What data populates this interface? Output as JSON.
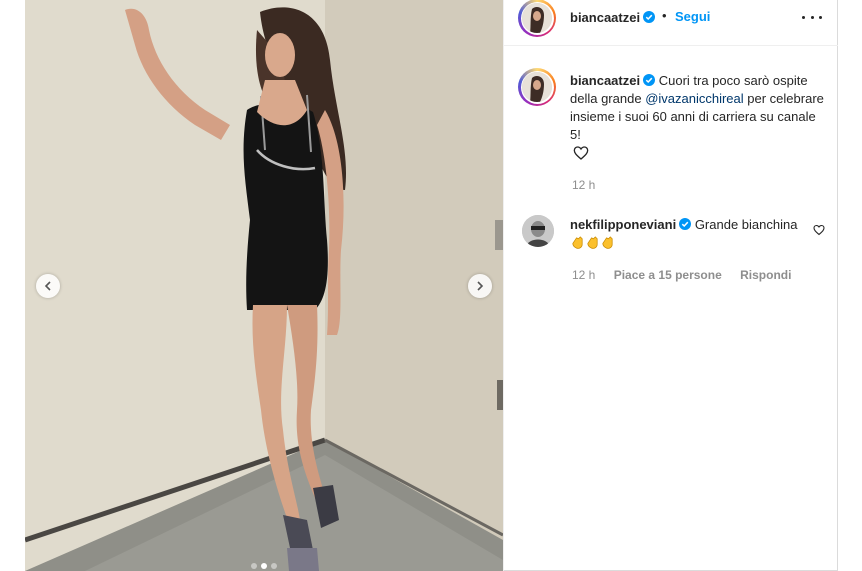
{
  "post": {
    "author": "biancaatzei",
    "follow_label": "Segui",
    "separator": "•",
    "caption": {
      "username": "biancaatzei",
      "text_before": "Cuori tra poco sarò ospite della grande",
      "mention": "@ivazanicchireal",
      "text_after": "per celebrare insieme i suoi 60 anni di carriera su canale 5!",
      "time": "12 h"
    },
    "comments": [
      {
        "username": "nekfilipponeviani",
        "text": "Grande bianchina",
        "emoji_count": 3,
        "time": "12 h",
        "likes": "Piace a 15 persone",
        "reply": "Rispondi"
      }
    ],
    "carousel": {
      "slides": 3,
      "active_index": 1
    }
  },
  "colors": {
    "link_blue": "#0095f6",
    "mention_blue": "#00376b",
    "secondary_text": "#8e8e8e",
    "verified_blue": "#0095f6"
  },
  "icons": {
    "verified": "verified-badge-icon",
    "more": "more-horizontal-icon",
    "like": "heart-icon",
    "prev": "chevron-left-icon",
    "next": "chevron-right-icon",
    "clap": "clapping-hands-emoji"
  }
}
